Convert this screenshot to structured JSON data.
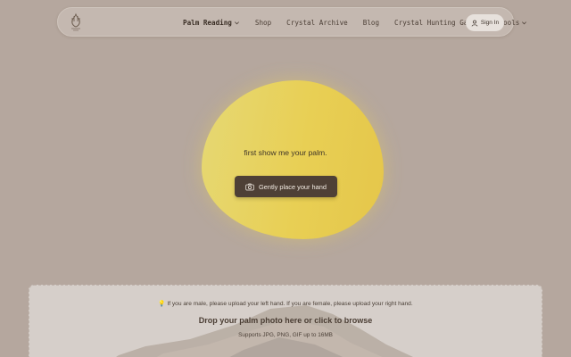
{
  "nav": {
    "items": [
      {
        "label": "Palm Reading",
        "has_dropdown": true,
        "active": true
      },
      {
        "label": "Shop",
        "has_dropdown": false
      },
      {
        "label": "Crystal Archive",
        "has_dropdown": false
      },
      {
        "label": "Blog",
        "has_dropdown": false
      },
      {
        "label": "Crystal Hunting Game",
        "has_dropdown": true
      },
      {
        "label": "Tools",
        "has_dropdown": true
      }
    ],
    "signin_label": "Sign In",
    "logo_icon": "palm-logo-icon"
  },
  "hero": {
    "prompt": "first show me your palm.",
    "button_label": "Gently place your hand",
    "button_icon": "camera-icon",
    "accent": "#e8cf54"
  },
  "upload": {
    "hint": "💡 If you are male, please upload your left hand. If you are female, please upload your right hand.",
    "title": "Drop your palm photo here or click to browse",
    "supports": "Supports JPG, PNG, GIF up to 16MB"
  },
  "colors": {
    "background": "#b5a79e",
    "button": "#4e4036",
    "dropzone": "#d6cfca"
  }
}
